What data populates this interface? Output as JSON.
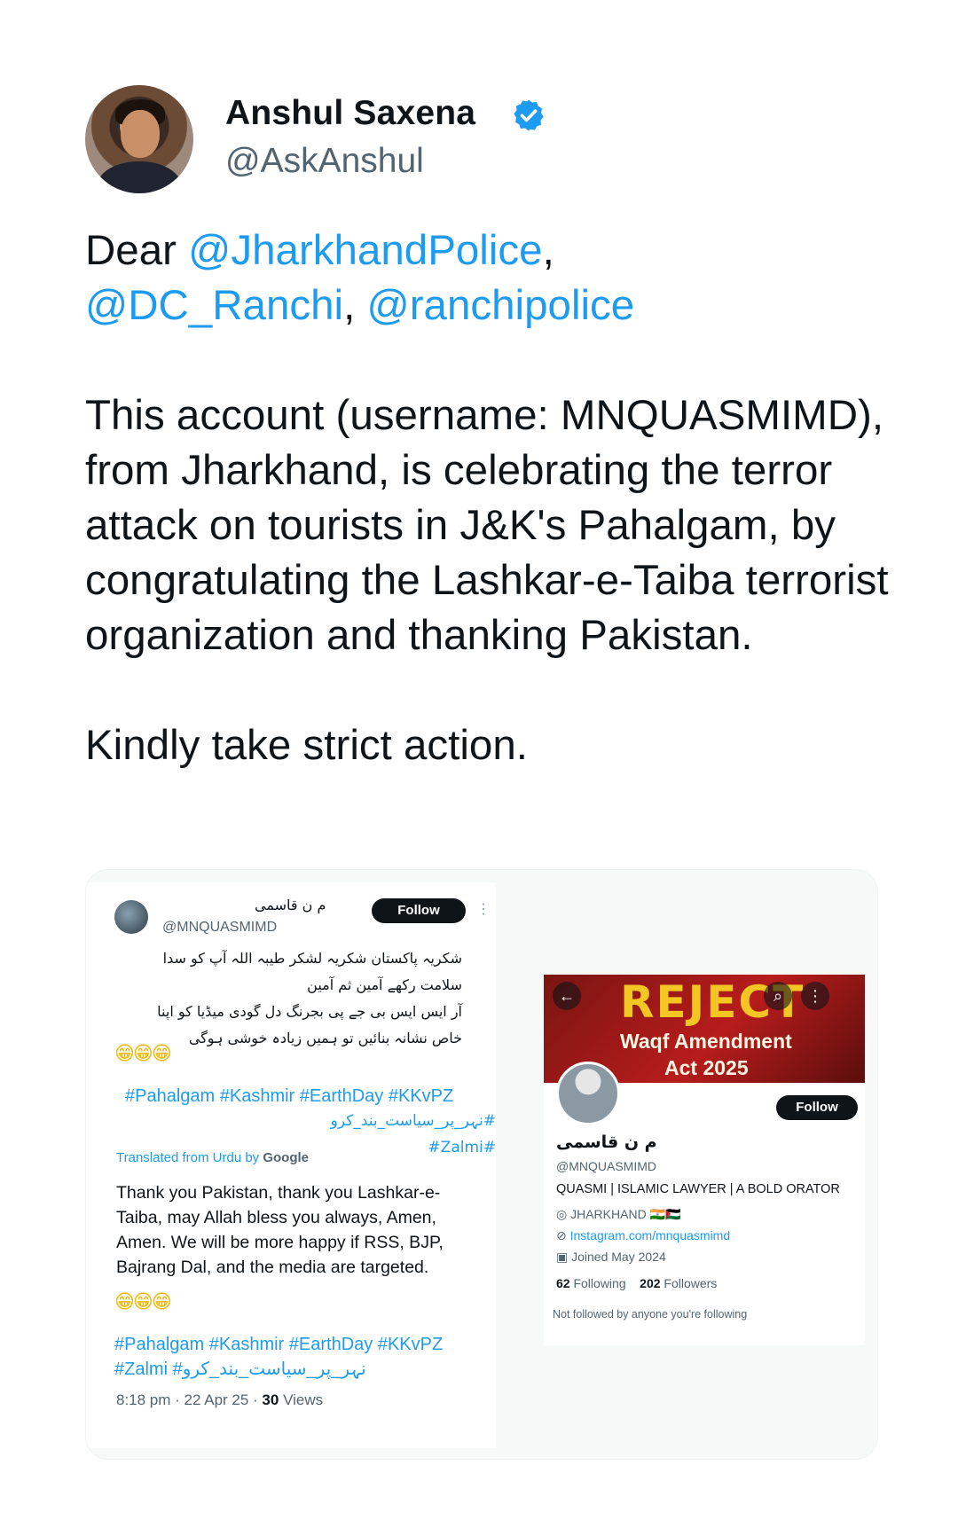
{
  "author": {
    "name": "Anshul Saxena",
    "handle": "@AskAnshul",
    "verified": true,
    "verified_color": "#1d9bf0"
  },
  "tweet": {
    "line1_prefix": "Dear ",
    "mention1": "@JharkhandPolice",
    "sep1": ",",
    "mention2": "@DC_Ranchi",
    "sep2": ", ",
    "mention3": "@ranchipolice",
    "paragraph": "This account (username: MNQUASMIMD), from Jharkhand, is celebrating the terror attack on tourists in  J&K's Pahalgam, by congratulating the Lashkar-e-Taiba terrorist organization and thanking Pakistan.",
    "closing": "Kindly take strict action.",
    "mention_color": "#1d9bf0"
  },
  "screenshot_left": {
    "name": "م ن قاسمی",
    "handle": "@MNQUASMIMD",
    "follow_label": "Follow",
    "urdu_lines": [
      "شکریہ پاکستان شکریہ لشکر طیبہ اللہ آپ کو سدا",
      "سلامت رکھے آمین ثم آمین",
      "آر ایس ایس بی جے پی بجرنگ دل گودی میڈیا کو اپنا",
      "خاص نشانہ بنائیں تو ہمیں زیادہ خوشی ہوگی"
    ],
    "emoji": "😁😁😁",
    "hashtags_urdu_line1": "#Pahalgam #Kashmir #EarthDay #KKvPZ",
    "hashtags_urdu_line2": "#نہر_پر_سیاست_بند_کرو #Zalmi#",
    "translated_label": "Translated from Urdu by",
    "translated_brand": "Google",
    "translation": "Thank you Pakistan, thank you Lashkar-e-Taiba, may Allah bless you always, Amen, Amen. We will be more happy if RSS, BJP, Bajrang Dal, and the media are targeted.",
    "hashtags_en_line1": "#Pahalgam #Kashmir #EarthDay #KKvPZ",
    "hashtags_en_line2": "#Zalmi #نہر_پر_سیاست_بند_کرو",
    "timestamp": "8:18 pm · 22 Apr 25 · ",
    "views_count": "30",
    "views_label": " Views"
  },
  "screenshot_right": {
    "banner_title": "REJECT",
    "banner_sub1": "Waqf Amendment",
    "banner_sub2": "Act 2025",
    "follow_label": "Follow",
    "name": "م ن قاسمی",
    "handle": "@MNQUASMIMD",
    "bio": "QUASMI | ISLAMIC LAWYER | A BOLD ORATOR",
    "location": "JHARKHAND 🇮🇳🇵🇸",
    "link": "Instagram.com/mnquasmimd",
    "joined": "Joined May 2024",
    "following_count": "62",
    "following_label": " Following",
    "followers_count": "202",
    "followers_label": " Followers",
    "note": "Not followed by anyone you're following"
  }
}
